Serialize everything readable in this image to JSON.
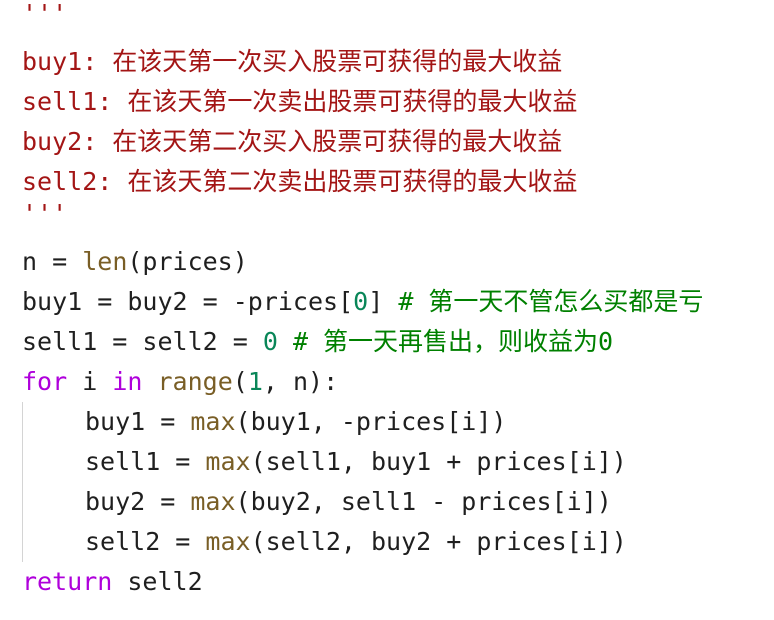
{
  "code": {
    "doc_open": "'''",
    "doc_lines": [
      "buy1: 在该天第一次买入股票可获得的最大收益",
      "sell1: 在该天第一次卖出股票可获得的最大收益",
      "buy2: 在该天第二次买入股票可获得的最大收益",
      "sell2: 在该天第二次卖出股票可获得的最大收益"
    ],
    "doc_close": "'''",
    "line_n": {
      "prefix": "n = ",
      "fn": "len",
      "suffix": "(prices)"
    },
    "line_buy": {
      "prefix": "buy1 = buy2 = -prices[",
      "num": "0",
      "suffix": "] ",
      "comment": "# 第一天不管怎么买都是亏"
    },
    "line_sell": {
      "prefix": "sell1 = sell2 = ",
      "num": "0",
      "gap": " ",
      "comment": "# 第一天再售出，则收益为0"
    },
    "line_for": {
      "kw_for": "for",
      "var": " i ",
      "kw_in": "in",
      "space": " ",
      "fn": "range",
      "open": "(",
      "num": "1",
      "suffix": ", n):"
    },
    "body": [
      {
        "prefix": "buy1 = ",
        "fn": "max",
        "suffix": "(buy1, -prices[i])"
      },
      {
        "prefix": "sell1 = ",
        "fn": "max",
        "suffix": "(sell1, buy1 + prices[i])"
      },
      {
        "prefix": "buy2 = ",
        "fn": "max",
        "suffix": "(buy2, sell1 - prices[i])"
      },
      {
        "prefix": "sell2 = ",
        "fn": "max",
        "suffix": "(sell2, buy2 + prices[i])"
      }
    ],
    "line_return": {
      "kw": "return",
      "suffix": " sell2"
    }
  },
  "colors": {
    "docstring": "#a31515",
    "keyword": "#af00db",
    "number": "#098658",
    "comment": "#008000",
    "builtin": "#795e26",
    "text": "#1f1f1f"
  }
}
